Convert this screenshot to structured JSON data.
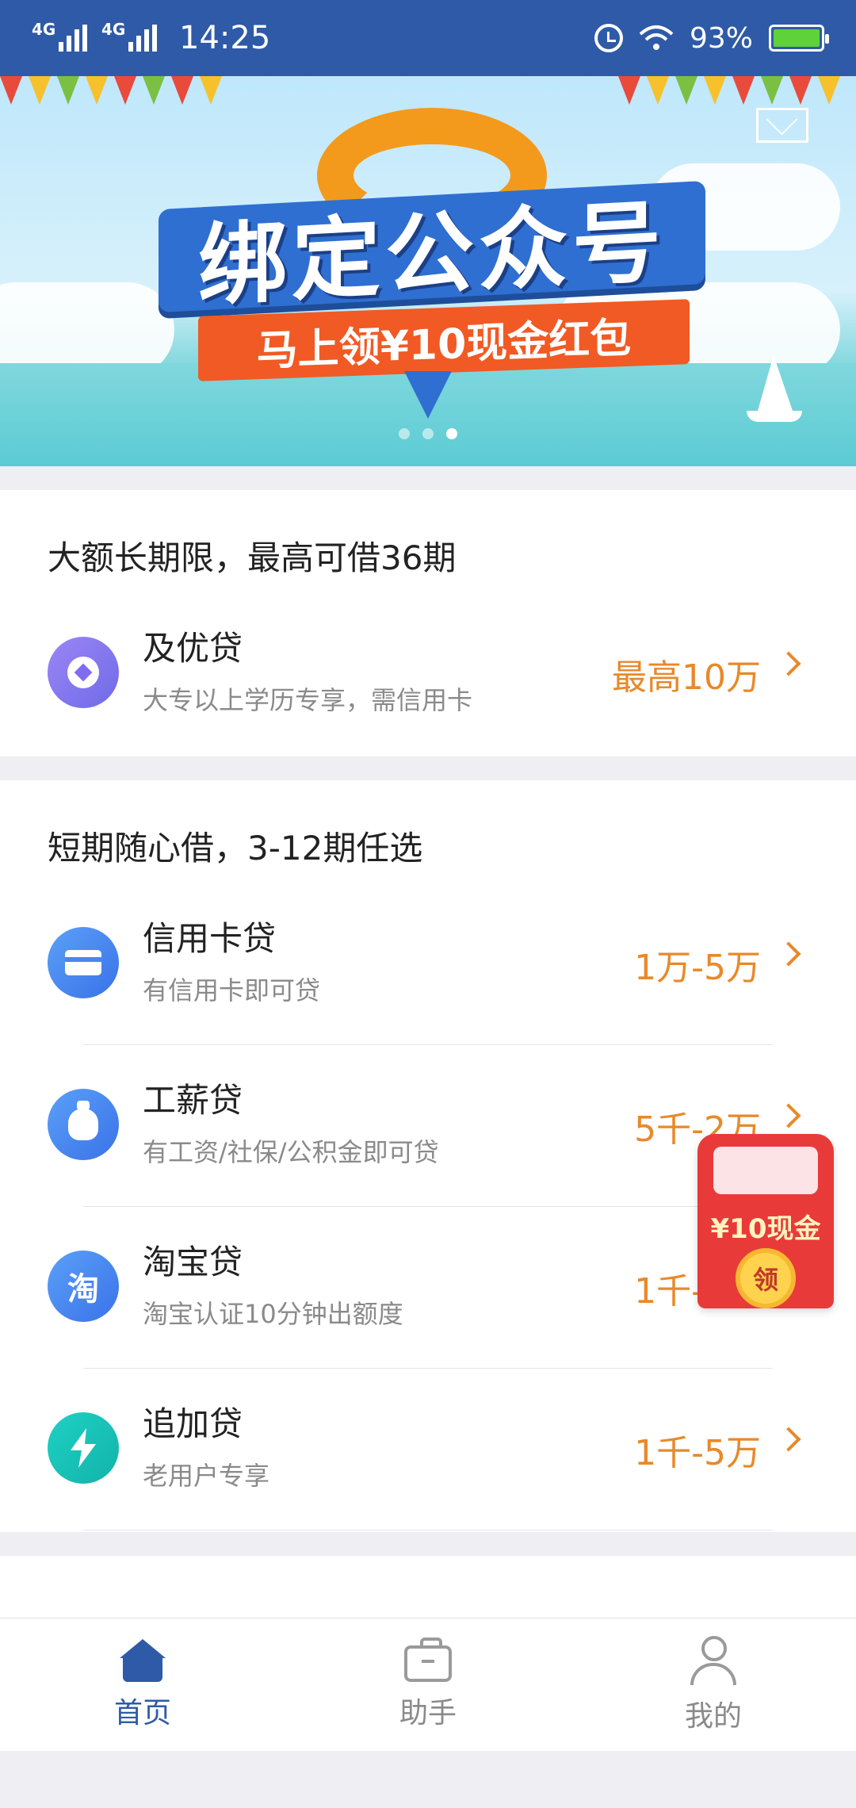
{
  "status_bar": {
    "network1": "4G",
    "network2": "4G",
    "time": "14:25",
    "battery": "93%"
  },
  "banner": {
    "title": "绑定公众号",
    "subtitle": "马上领¥10现金红包"
  },
  "section1": {
    "title": "大额长期限，最高可借36期",
    "items": [
      {
        "name": "及优贷",
        "desc": "大专以上学历专享，需信用卡",
        "amount": "最高10万",
        "icon": "diamond-icon"
      }
    ]
  },
  "section2": {
    "title": "短期随心借，3-12期任选",
    "items": [
      {
        "name": "信用卡贷",
        "desc": "有信用卡即可贷",
        "amount": "1万-5万",
        "icon": "credit-card-icon"
      },
      {
        "name": "工薪贷",
        "desc": "有工资/社保/公积金即可贷",
        "amount": "5千-2万",
        "icon": "money-bag-icon"
      },
      {
        "name": "淘宝贷",
        "desc": "淘宝认证10分钟出额度",
        "amount": "1千-5万",
        "icon": "taobao-icon",
        "icon_glyph": "淘"
      },
      {
        "name": "追加贷",
        "desc": "老用户专享",
        "amount": "1千-5万",
        "icon": "lightning-icon"
      }
    ]
  },
  "red_packet": {
    "text": "¥10现金",
    "button": "领"
  },
  "tabbar": {
    "tabs": [
      {
        "label": "首页",
        "icon": "home-icon",
        "active": true
      },
      {
        "label": "助手",
        "icon": "briefcase-icon",
        "active": false
      },
      {
        "label": "我的",
        "icon": "user-icon",
        "active": false
      }
    ]
  },
  "colors": {
    "primary": "#2f5aa8",
    "amount": "#e8892a",
    "red_packet": "#e93a3a"
  }
}
